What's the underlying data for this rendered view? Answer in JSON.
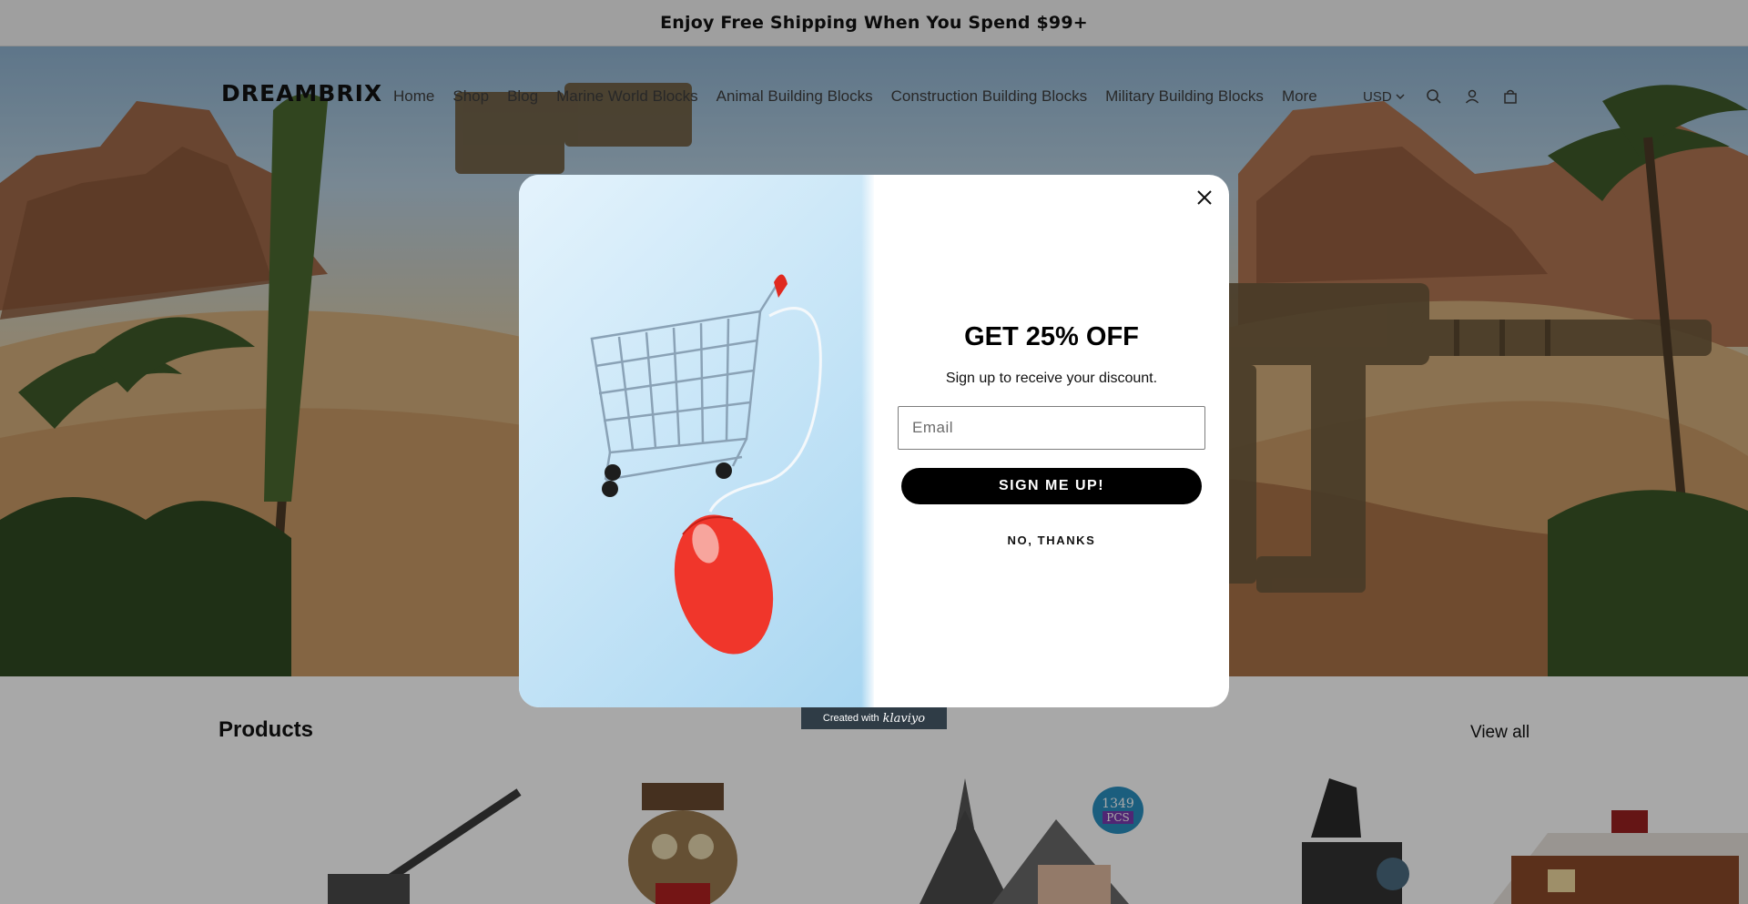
{
  "announcement": {
    "text": "Enjoy Free Shipping When You Spend $99+"
  },
  "header": {
    "logo": "DREAMBRIX",
    "nav": [
      "Home",
      "Shop",
      "Blog",
      "Marine World Blocks",
      "Animal Building Blocks",
      "Construction Building Blocks",
      "Military Building Blocks",
      "More"
    ],
    "currency": "USD",
    "icons": [
      "search-icon",
      "account-icon",
      "cart-icon"
    ]
  },
  "popup": {
    "title": "GET 25% OFF",
    "subtitle": "Sign up to receive your discount.",
    "email_placeholder": "Email",
    "email_value": "",
    "signup_label": "SIGN ME UP!",
    "decline_label": "NO, THANKS",
    "close_icon": "close-icon",
    "image": "shopping-cart-with-mouse"
  },
  "klaviyo_badge": {
    "prefix": "Created with",
    "brand": "klaviyo"
  },
  "products": {
    "title": "Products",
    "view_all": "View all",
    "badge_count": "1349",
    "badge_unit": "PCS"
  },
  "colors": {
    "overlay": "rgba(0,0,0,0.34)",
    "button": "#000000",
    "announcement_bg": "#f1f1f1"
  }
}
